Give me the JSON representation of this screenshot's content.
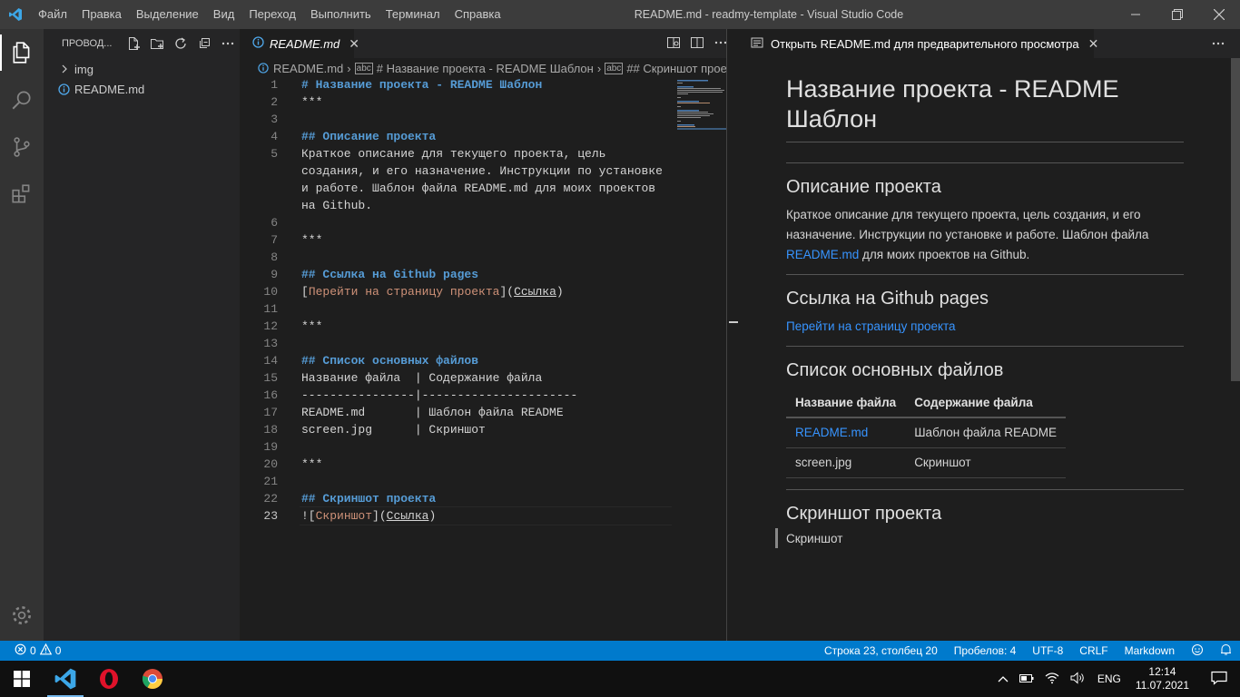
{
  "titlebar": {
    "menu": [
      "Файл",
      "Правка",
      "Выделение",
      "Вид",
      "Переход",
      "Выполнить",
      "Терминал",
      "Справка"
    ],
    "title": "README.md - readmy-template - Visual Studio Code"
  },
  "sidebar": {
    "title": "ПРОВОД...",
    "items": [
      {
        "label": "img",
        "type": "folder"
      },
      {
        "label": "README.md",
        "type": "file"
      }
    ]
  },
  "editor": {
    "tab_label": "README.md",
    "breadcrumbs": [
      "README.md",
      "# Название проекта - README Шаблон",
      "## Скриншот проекта"
    ],
    "lines": [
      {
        "n": "1",
        "text": "# Название проекта - README Шаблон"
      },
      {
        "n": "2",
        "text": "***"
      },
      {
        "n": "3",
        "text": ""
      },
      {
        "n": "4",
        "text": "## Описание проекта"
      },
      {
        "n": "5",
        "text": "Краткое описание для текущего проекта, цель"
      },
      {
        "n": "",
        "text": "создания, и его назначение. Инструкции по установке"
      },
      {
        "n": "",
        "text": "и работе. Шаблон файла README.md для моих проектов"
      },
      {
        "n": "",
        "text": "на Github."
      },
      {
        "n": "6",
        "text": ""
      },
      {
        "n": "7",
        "text": "***"
      },
      {
        "n": "8",
        "text": ""
      },
      {
        "n": "9",
        "text": "## Ссылка на Github pages"
      },
      {
        "n": "10",
        "text": "[Перейти на страницу проекта](Ссылка)"
      },
      {
        "n": "11",
        "text": ""
      },
      {
        "n": "12",
        "text": "***"
      },
      {
        "n": "13",
        "text": ""
      },
      {
        "n": "14",
        "text": "## Список основных файлов"
      },
      {
        "n": "15",
        "text": "Название файла  | Содержание файла"
      },
      {
        "n": "16",
        "text": "----------------|----------------------"
      },
      {
        "n": "17",
        "text": "README.md       | Шаблон файла README"
      },
      {
        "n": "18",
        "text": "screen.jpg      | Скриншот"
      },
      {
        "n": "19",
        "text": ""
      },
      {
        "n": "20",
        "text": "***"
      },
      {
        "n": "21",
        "text": ""
      },
      {
        "n": "22",
        "text": "## Скриншот проекта"
      },
      {
        "n": "23",
        "text": "![Скриншот](Ссылка)"
      }
    ]
  },
  "preview": {
    "tab_label": "Открыть README.md для предварительного просмотра",
    "h1": "Название проекта - README Шаблон",
    "h2_description": "Описание проекта",
    "description_1": "Краткое описание для текущего проекта, цель создания, и его назначение. Инструкции по установке и работе. Шаблон файла",
    "description_link": "README.md",
    "description_2": "для моих проектов на Github.",
    "h2_pages": "Ссылка на Github pages",
    "pages_link": "Перейти на страницу проекта",
    "h2_files": "Список основных файлов",
    "table": {
      "headers": [
        "Название файла",
        "Содержание файла"
      ],
      "rows": [
        [
          "README.md",
          "Шаблон файла README"
        ],
        [
          "screen.jpg",
          "Скриншот"
        ]
      ]
    },
    "h2_screenshot": "Скриншот проекта",
    "image_alt": "Скриншот"
  },
  "statusbar": {
    "errors": "0",
    "warnings": "0",
    "position": "Строка 23, столбец 20",
    "spaces": "Пробелов: 4",
    "encoding": "UTF-8",
    "eol": "CRLF",
    "language": "Markdown"
  },
  "taskbar": {
    "lang": "ENG",
    "time": "12:14",
    "date": "11.07.2021"
  },
  "colors": {
    "accent": "#007acc",
    "link": "#3794ff",
    "heading": "#569cd6"
  }
}
